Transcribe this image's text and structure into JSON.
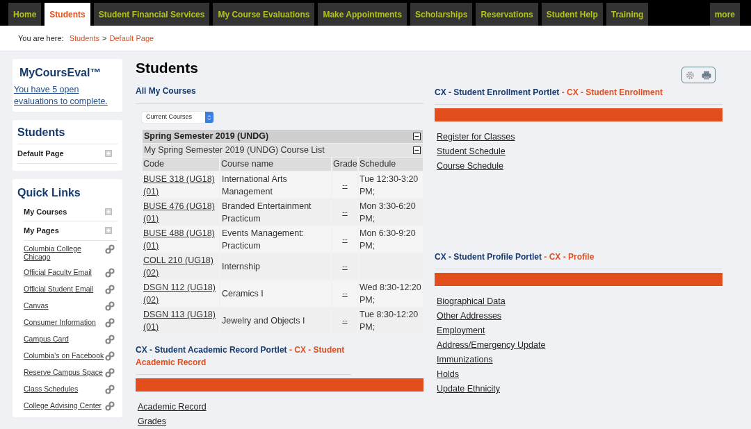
{
  "nav_tabs": [
    {
      "label": "Home",
      "selected": false
    },
    {
      "label": "Students",
      "selected": true
    },
    {
      "label": "Student Financial Services",
      "selected": false
    },
    {
      "label": "My Course Evaluations",
      "selected": false
    },
    {
      "label": "Make Appointments",
      "selected": false
    },
    {
      "label": "Scholarships",
      "selected": false
    },
    {
      "label": "Reservations",
      "selected": false
    },
    {
      "label": "Student Help",
      "selected": false
    },
    {
      "label": "Training",
      "selected": false
    },
    {
      "label": "more",
      "selected": false
    }
  ],
  "breadcrumb": {
    "label": "You are here:",
    "items": [
      "Students",
      "Default Page"
    ],
    "separator": ">"
  },
  "sidebar": {
    "eval_box": {
      "title": "MyCoursEval™",
      "link": "You have 5 open evaluations to complete."
    },
    "students_box": {
      "title": "Students",
      "items": [
        {
          "label": "Default Page",
          "kind": "section"
        }
      ]
    },
    "quick_links": {
      "title": "Quick Links",
      "items": [
        {
          "label": "My Courses",
          "kind": "section"
        },
        {
          "label": "My Pages",
          "kind": "section"
        },
        {
          "label": "Columbia College Chicago",
          "kind": "link"
        },
        {
          "label": "Official Faculty Email",
          "kind": "link"
        },
        {
          "label": "Official Student Email",
          "kind": "link"
        },
        {
          "label": "Canvas",
          "kind": "link"
        },
        {
          "label": "Consumer Information",
          "kind": "link"
        },
        {
          "label": "Campus Card",
          "kind": "link"
        },
        {
          "label": "Columbia's on Facebook",
          "kind": "link"
        },
        {
          "label": "Reserve Campus Space",
          "kind": "link"
        },
        {
          "label": "Class Schedules",
          "kind": "link"
        },
        {
          "label": "College Advising Center",
          "kind": "link"
        }
      ]
    }
  },
  "page_title": "Students",
  "courses": {
    "title": "All My Courses",
    "filter": "Current Courses",
    "term": "Spring Semester 2019 (UNDG)",
    "list_title": "My Spring Semester 2019 (UNDG) Course List",
    "columns": [
      "Code",
      "Course name",
      "Grade",
      "Schedule"
    ],
    "rows": [
      {
        "code": "BUSE 318 (UG18) (01)",
        "name": "International Arts Management",
        "grade": "--",
        "schedule": "Tue 12:30-3:20 PM;"
      },
      {
        "code": "BUSE 476 (UG18) (01)",
        "name": "Branded Entertainment Practicum",
        "grade": "--",
        "schedule": "Mon 3:30-6:20 PM;"
      },
      {
        "code": "BUSE 488 (UG18) (01)",
        "name": "Events Management: Practicum",
        "grade": "--",
        "schedule": "Mon 6:30-9:20 PM;"
      },
      {
        "code": "COLL 210 (UG18) (02)",
        "name": "Internship",
        "grade": "--"
      },
      {
        "code": "DSGN 112 (UG18) (02)",
        "name": "Ceramics I",
        "grade": "--",
        "schedule": "Wed 8:30-12:20 PM;"
      },
      {
        "code": "DSGN 113 (UG18) (01)",
        "name": "Jewelry and Objects I",
        "grade": "--",
        "schedule": "Tue 8:30-12:20 PM;"
      }
    ]
  },
  "portlets": [
    {
      "title": "CX - Student Academic Record Portlet",
      "subtitle": "- CX - Student Academic Record",
      "links": [
        "Academic Record",
        "Grades"
      ]
    },
    {
      "title": "CX - Student Enrollment Portlet",
      "subtitle": "- CX - Student Enrollment",
      "links": [
        "Register for Classes",
        "Student Schedule",
        "Course Schedule"
      ]
    },
    {
      "title": "CX - Student Profile Portlet",
      "subtitle": "- CX - Profile",
      "links": [
        "Biographical Data",
        "Other Addresses",
        "Employment",
        "Address/Emergency Update",
        "Immunizations",
        "Holds",
        "Update Ethnicity"
      ]
    }
  ]
}
